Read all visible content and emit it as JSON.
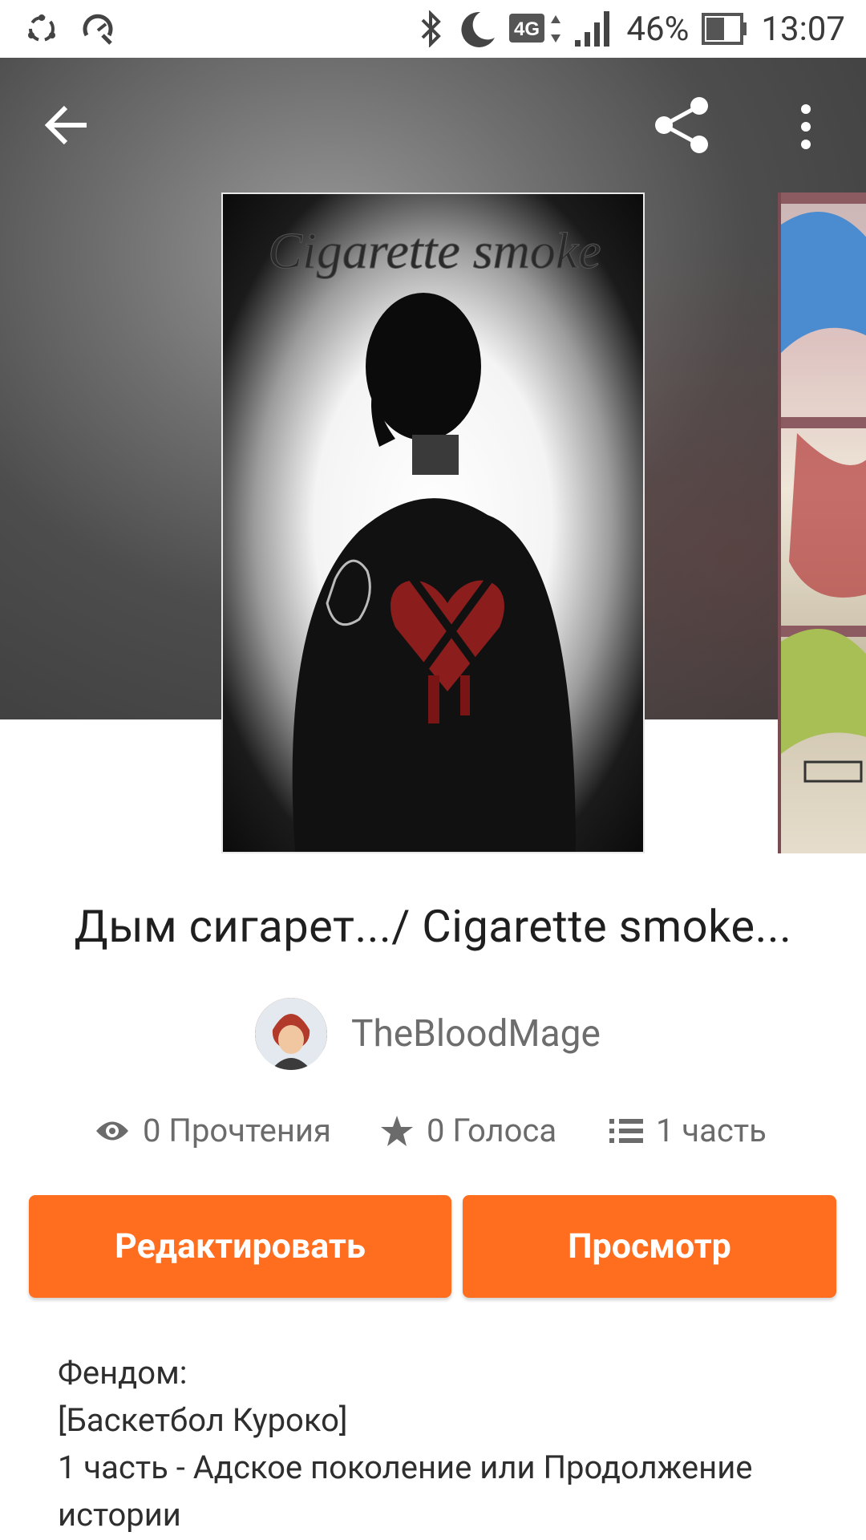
{
  "status_bar": {
    "battery": "46%",
    "time": "13:07",
    "network": "4G"
  },
  "toolbar": {
    "back_icon": "arrow-left-icon",
    "share_icon": "share-icon",
    "more_icon": "more-vert-icon"
  },
  "story": {
    "title": "Дым сигарет.../ Cigarette smoke...",
    "cover_text": "Cigarette smoke",
    "author": "TheBloodMage"
  },
  "stats": {
    "reads": "0 Прочтения",
    "votes": "0 Голоса",
    "parts": "1 часть"
  },
  "actions": {
    "edit_label": "Редактировать",
    "view_label": "Просмотр"
  },
  "description": {
    "lines": [
      "Фендом:",
      "[Баскетбол Куроко]",
      "1 часть - Адское поколение или Продолжение",
      "истории"
    ]
  },
  "colors": {
    "accent": "#ff6d1f",
    "text": "#1f1f1f",
    "muted": "#6b6b6b"
  }
}
